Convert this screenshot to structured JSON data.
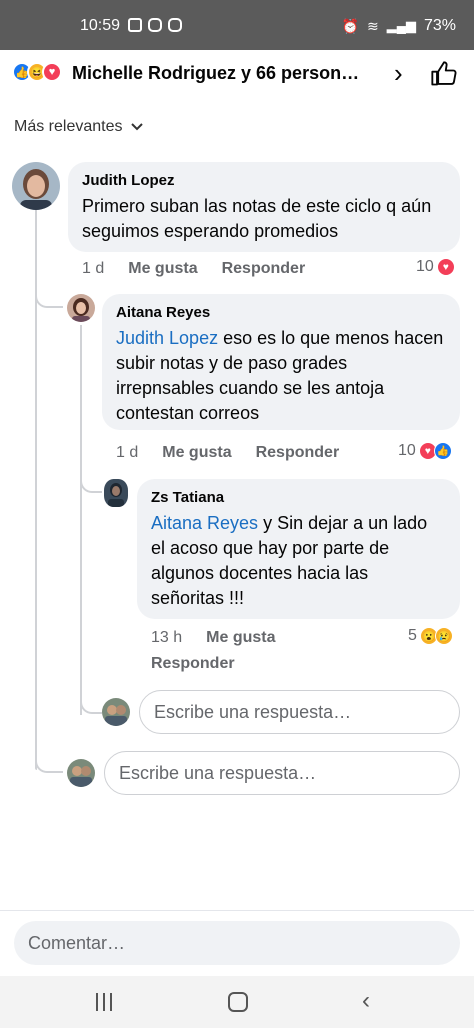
{
  "status_bar": {
    "time": "10:59",
    "battery": "73%"
  },
  "header": {
    "title": "Michelle Rodriguez y 66 person…",
    "reactions": [
      "like-icon",
      "haha-icon",
      "love-icon"
    ]
  },
  "sort": {
    "label": "Más relevantes"
  },
  "comments": [
    {
      "author": "Judith Lopez",
      "text": "Primero suban las notas de este ciclo q aún seguimos esperando promedios",
      "time": "1 d",
      "like_label": "Me gusta",
      "reply_label": "Responder",
      "reaction_count": "10"
    },
    {
      "author": "Aitana Reyes",
      "mention": "Judith Lopez",
      "text": " eso es lo que menos hacen subir notas y de paso grades irrepnsables cuando se les antoja contestan correos",
      "time": "1 d",
      "like_label": "Me gusta",
      "reply_label": "Responder",
      "reaction_count": "10"
    },
    {
      "author": "Zs Tatiana",
      "mention": "Aitana Reyes",
      "text": " y Sin dejar a un lado el acoso que hay por parte de algunos docentes hacia las señoritas !!!",
      "time": "13 h",
      "like_label": "Me gusta",
      "reply_label": "Responder",
      "reaction_count": "5"
    }
  ],
  "reply_inputs": {
    "nested_placeholder": "Escribe una respuesta…",
    "thread_placeholder": "Escribe una respuesta…"
  },
  "comment_bar": {
    "placeholder": "Comentar…"
  },
  "colors": {
    "brand_blue": "#1877f2",
    "mention_blue": "#1a6ec2",
    "bubble_bg": "#f0f2f5",
    "love_red": "#f33e58"
  }
}
